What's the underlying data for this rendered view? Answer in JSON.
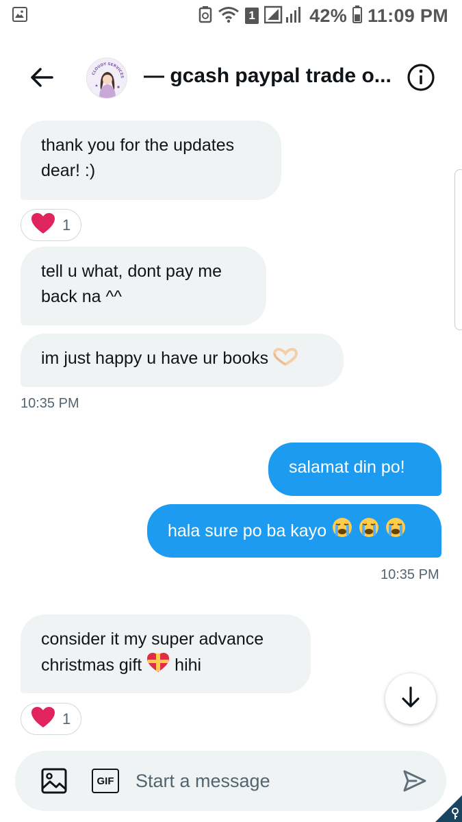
{
  "status_bar": {
    "battery": "42%",
    "time": "11:09 PM",
    "sim_badge": "1",
    "icons": [
      "gallery-icon",
      "recycle-icon",
      "wifi-icon",
      "signal-icon",
      "battery-icon"
    ]
  },
  "header": {
    "title": "— gcash paypal trade o...",
    "avatar_text": "CLOUDY SERVICES",
    "icons": [
      "back-arrow-icon",
      "info-icon"
    ]
  },
  "messages": [
    {
      "direction": "in",
      "lines": [
        "thank you for the updates",
        "dear! :)"
      ]
    },
    {
      "direction": "in",
      "lines": [
        "tell u what, dont pay me",
        "back na ^^"
      ]
    },
    {
      "direction": "in",
      "text": "im just happy u have ur books",
      "emoji": "heart-hands-emoji"
    },
    {
      "direction": "out",
      "text": "salamat din po!"
    },
    {
      "direction": "out",
      "text": "hala sure po ba kayo",
      "emoji": "crying-face-emoji x3"
    },
    {
      "direction": "in",
      "line1": "consider it my super advance",
      "line2_pre": "christmas gift",
      "line2_post": "hihi",
      "emoji": "heart-gift-emoji"
    }
  ],
  "reactions": [
    {
      "emoji": "red-heart",
      "count": "1"
    },
    {
      "emoji": "red-heart",
      "count": "1"
    }
  ],
  "timestamps": {
    "first": "10:35 PM",
    "second": "10:35 PM"
  },
  "composer": {
    "placeholder": "Start a message",
    "gif_label": "GIF",
    "icons": [
      "image-icon",
      "send-icon"
    ]
  },
  "colors": {
    "accent": "#1d9bf0",
    "incoming_bubble": "#eff3f4",
    "secondary_text": "#536471",
    "heart": "#e0245e"
  }
}
